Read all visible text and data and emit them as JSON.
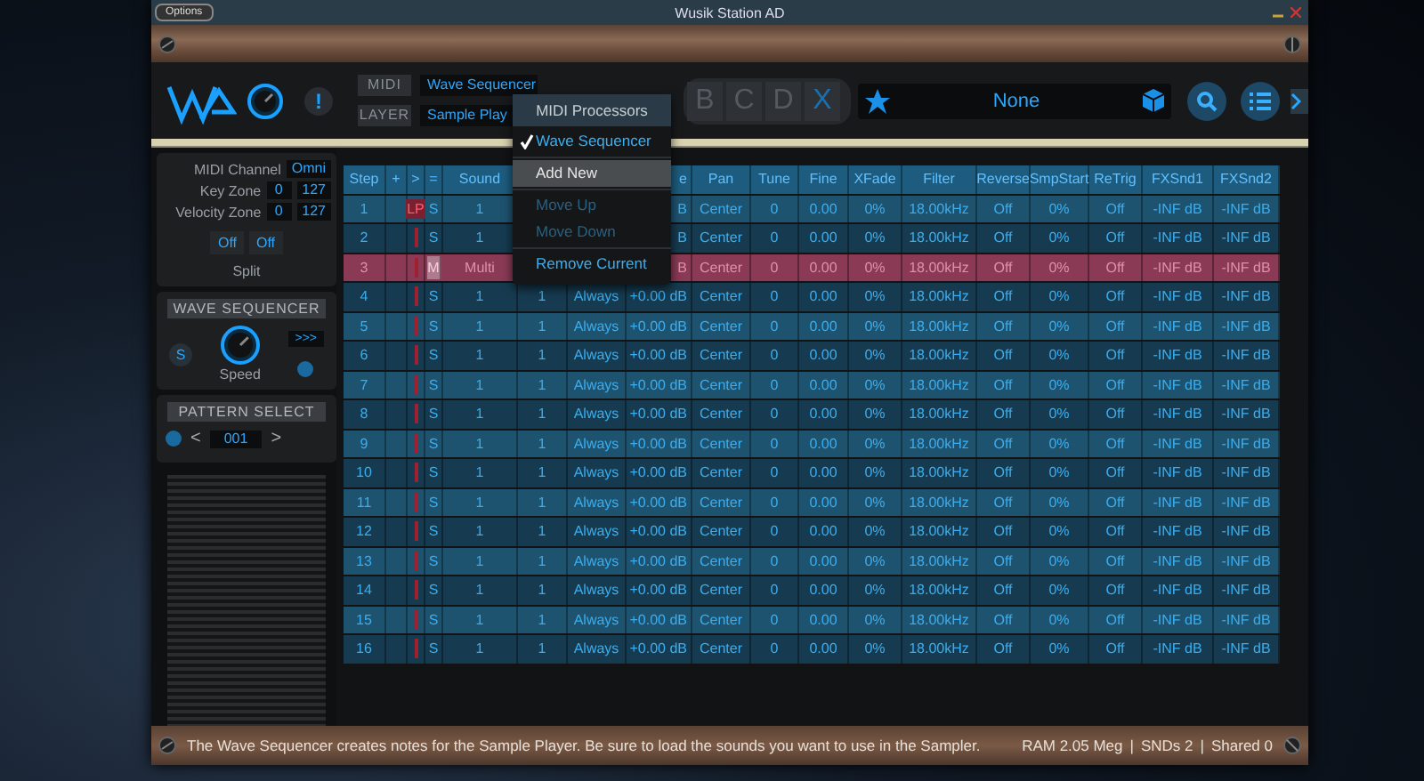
{
  "window": {
    "title": "Wusik Station AD",
    "options_button": "Options"
  },
  "toolbar": {
    "alert": "!",
    "midi_label": "MIDI",
    "midi_value": "Wave Sequencer",
    "layer_label": "LAYER",
    "layer_value": "Sample Play",
    "layer_tabs": [
      {
        "label": "B",
        "kind": "layer"
      },
      {
        "label": "C",
        "kind": "layer"
      },
      {
        "label": "D",
        "kind": "layer"
      },
      {
        "label": "X",
        "kind": "delete"
      }
    ],
    "preset": "None"
  },
  "side_panel": {
    "midi_channel": {
      "label": "MIDI Channel",
      "value": "Omni"
    },
    "key_zone": {
      "label": "Key Zone",
      "low": "0",
      "high": "127"
    },
    "velocity_zone": {
      "label": "Velocity Zone",
      "low": "0",
      "high": "127"
    },
    "split": {
      "buttons": [
        "Off",
        "Off"
      ],
      "label": "Split"
    },
    "wave_sequencer": {
      "title": "WAVE SEQUENCER",
      "s_button": "S",
      "fast_button": ">>>",
      "speed_label": "Speed"
    },
    "pattern_select": {
      "title": "PATTERN SELECT",
      "prev": "<",
      "value": "001",
      "next": ">"
    }
  },
  "table": {
    "columns": [
      "Step",
      "+",
      ">",
      "=",
      "Sound",
      null,
      null,
      "e",
      "Pan",
      "Tune",
      "Fine",
      "XFade",
      "Filter",
      "Reverse",
      "SmpStart",
      "ReTrig",
      "FXSnd1",
      "FXSnd2"
    ],
    "rows": [
      {
        "selected": false,
        "cells": [
          "1",
          "",
          "LP",
          "S",
          "1",
          null,
          null,
          "B",
          "Center",
          "0",
          "0.00",
          "0%",
          "18.00kHz",
          "Off",
          "0%",
          "Off",
          "-INF dB",
          "-INF dB"
        ]
      },
      {
        "selected": false,
        "cells": [
          "2",
          "",
          "",
          "S",
          "1",
          null,
          null,
          "B",
          "Center",
          "0",
          "0.00",
          "0%",
          "18.00kHz",
          "Off",
          "0%",
          "Off",
          "-INF dB",
          "-INF dB"
        ]
      },
      {
        "selected": true,
        "cells": [
          "3",
          "",
          "",
          "M",
          "Multi",
          null,
          null,
          "B",
          "Center",
          "0",
          "0.00",
          "0%",
          "18.00kHz",
          "Off",
          "0%",
          "Off",
          "-INF dB",
          "-INF dB"
        ]
      },
      {
        "selected": false,
        "cells": [
          "4",
          "",
          "",
          "S",
          "1",
          "1",
          "Always",
          "+0.00 dB",
          "Center",
          "0",
          "0.00",
          "0%",
          "18.00kHz",
          "Off",
          "0%",
          "Off",
          "-INF dB",
          "-INF dB"
        ]
      },
      {
        "selected": false,
        "cells": [
          "5",
          "",
          "",
          "S",
          "1",
          "1",
          "Always",
          "+0.00 dB",
          "Center",
          "0",
          "0.00",
          "0%",
          "18.00kHz",
          "Off",
          "0%",
          "Off",
          "-INF dB",
          "-INF dB"
        ]
      },
      {
        "selected": false,
        "cells": [
          "6",
          "",
          "",
          "S",
          "1",
          "1",
          "Always",
          "+0.00 dB",
          "Center",
          "0",
          "0.00",
          "0%",
          "18.00kHz",
          "Off",
          "0%",
          "Off",
          "-INF dB",
          "-INF dB"
        ]
      },
      {
        "selected": false,
        "cells": [
          "7",
          "",
          "",
          "S",
          "1",
          "1",
          "Always",
          "+0.00 dB",
          "Center",
          "0",
          "0.00",
          "0%",
          "18.00kHz",
          "Off",
          "0%",
          "Off",
          "-INF dB",
          "-INF dB"
        ]
      },
      {
        "selected": false,
        "cells": [
          "8",
          "",
          "",
          "S",
          "1",
          "1",
          "Always",
          "+0.00 dB",
          "Center",
          "0",
          "0.00",
          "0%",
          "18.00kHz",
          "Off",
          "0%",
          "Off",
          "-INF dB",
          "-INF dB"
        ]
      },
      {
        "selected": false,
        "cells": [
          "9",
          "",
          "",
          "S",
          "1",
          "1",
          "Always",
          "+0.00 dB",
          "Center",
          "0",
          "0.00",
          "0%",
          "18.00kHz",
          "Off",
          "0%",
          "Off",
          "-INF dB",
          "-INF dB"
        ]
      },
      {
        "selected": false,
        "cells": [
          "10",
          "",
          "",
          "S",
          "1",
          "1",
          "Always",
          "+0.00 dB",
          "Center",
          "0",
          "0.00",
          "0%",
          "18.00kHz",
          "Off",
          "0%",
          "Off",
          "-INF dB",
          "-INF dB"
        ]
      },
      {
        "selected": false,
        "cells": [
          "11",
          "",
          "",
          "S",
          "1",
          "1",
          "Always",
          "+0.00 dB",
          "Center",
          "0",
          "0.00",
          "0%",
          "18.00kHz",
          "Off",
          "0%",
          "Off",
          "-INF dB",
          "-INF dB"
        ]
      },
      {
        "selected": false,
        "cells": [
          "12",
          "",
          "",
          "S",
          "1",
          "1",
          "Always",
          "+0.00 dB",
          "Center",
          "0",
          "0.00",
          "0%",
          "18.00kHz",
          "Off",
          "0%",
          "Off",
          "-INF dB",
          "-INF dB"
        ]
      },
      {
        "selected": false,
        "cells": [
          "13",
          "",
          "",
          "S",
          "1",
          "1",
          "Always",
          "+0.00 dB",
          "Center",
          "0",
          "0.00",
          "0%",
          "18.00kHz",
          "Off",
          "0%",
          "Off",
          "-INF dB",
          "-INF dB"
        ]
      },
      {
        "selected": false,
        "cells": [
          "14",
          "",
          "",
          "S",
          "1",
          "1",
          "Always",
          "+0.00 dB",
          "Center",
          "0",
          "0.00",
          "0%",
          "18.00kHz",
          "Off",
          "0%",
          "Off",
          "-INF dB",
          "-INF dB"
        ]
      },
      {
        "selected": false,
        "cells": [
          "15",
          "",
          "",
          "S",
          "1",
          "1",
          "Always",
          "+0.00 dB",
          "Center",
          "0",
          "0.00",
          "0%",
          "18.00kHz",
          "Off",
          "0%",
          "Off",
          "-INF dB",
          "-INF dB"
        ]
      },
      {
        "selected": false,
        "cells": [
          "16",
          "",
          "",
          "S",
          "1",
          "1",
          "Always",
          "+0.00 dB",
          "Center",
          "0",
          "0.00",
          "0%",
          "18.00kHz",
          "Off",
          "0%",
          "Off",
          "-INF dB",
          "-INF dB"
        ]
      }
    ]
  },
  "menu": {
    "title": "MIDI Processors",
    "groups": [
      {
        "items": [
          {
            "label": "Wave Sequencer",
            "checked": true,
            "selected": false,
            "disabled": false
          }
        ]
      },
      {
        "items": [
          {
            "label": "Add New",
            "checked": false,
            "selected": true,
            "disabled": false
          }
        ]
      },
      {
        "items": [
          {
            "label": "Move Up",
            "checked": false,
            "selected": false,
            "disabled": true
          },
          {
            "label": "Move Down",
            "checked": false,
            "selected": false,
            "disabled": true
          }
        ]
      },
      {
        "items": [
          {
            "label": "Remove Current",
            "checked": false,
            "selected": false,
            "disabled": false
          }
        ]
      }
    ]
  },
  "status_bar": {
    "message": "The Wave Sequencer creates notes for the Sample Player. Be sure to load the sounds you want to use in the Sampler.",
    "stats": [
      "RAM 2.05 Meg",
      "SNDs 2",
      "Shared 0"
    ],
    "separator": "|"
  }
}
